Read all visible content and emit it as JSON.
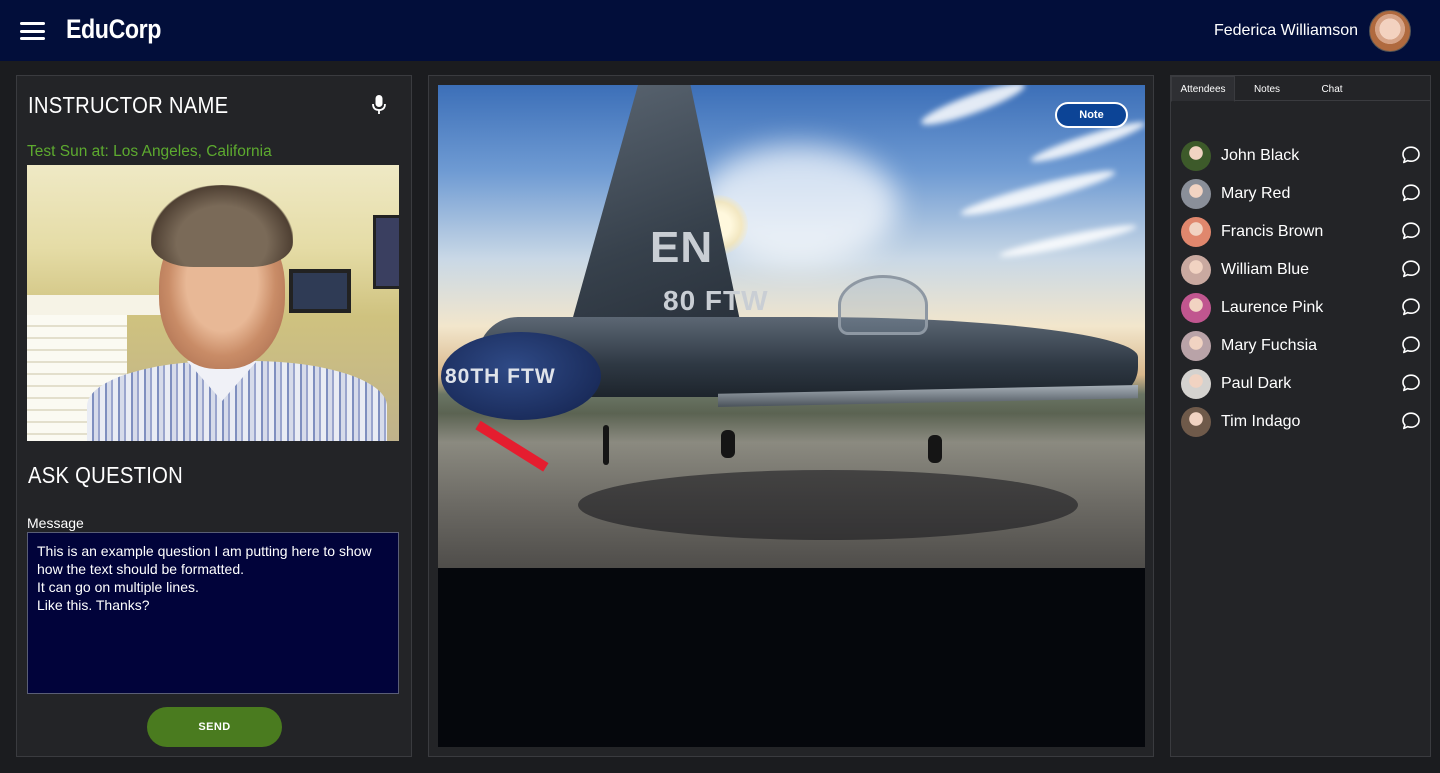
{
  "header": {
    "brand": "EduCorp",
    "user_name": "Federica Williamson"
  },
  "instructor": {
    "title": "INSTRUCTOR NAME",
    "location": "Test Sun at: Los Angeles, California"
  },
  "ask": {
    "title": "ASK QUESTION",
    "message_label": "Message",
    "message_value": "This is an example question I am putting here to show how the text should be formatted.\nIt can go on multiple lines.\nLike this. Thanks?",
    "send_label": "SEND"
  },
  "presentation": {
    "note_label": "Note",
    "tail_code": "EN",
    "tail_unit": "80 FTW",
    "cover_text": "80TH FTW"
  },
  "sidebar": {
    "tabs": [
      {
        "label": "Attendees",
        "active": true
      },
      {
        "label": "Notes",
        "active": false
      },
      {
        "label": "Chat",
        "active": false
      }
    ],
    "attendees": [
      {
        "name": "John Black",
        "avatar_color": "#3d5a2a"
      },
      {
        "name": "Mary Red",
        "avatar_color": "#8a8f99"
      },
      {
        "name": "Francis Brown",
        "avatar_color": "#e0876d"
      },
      {
        "name": "William Blue",
        "avatar_color": "#c9a9a0"
      },
      {
        "name": "Laurence Pink",
        "avatar_color": "#c0568f"
      },
      {
        "name": "Mary Fuchsia",
        "avatar_color": "#b9a3a8"
      },
      {
        "name": "Paul Dark",
        "avatar_color": "#d4d2cf"
      },
      {
        "name": "Tim Indago",
        "avatar_color": "#6f5a4a"
      }
    ]
  },
  "colors": {
    "header_bg": "#020e3a",
    "accent_green": "#4a7b1f",
    "location_green": "#5daa2f",
    "note_blue": "#0c4496"
  }
}
